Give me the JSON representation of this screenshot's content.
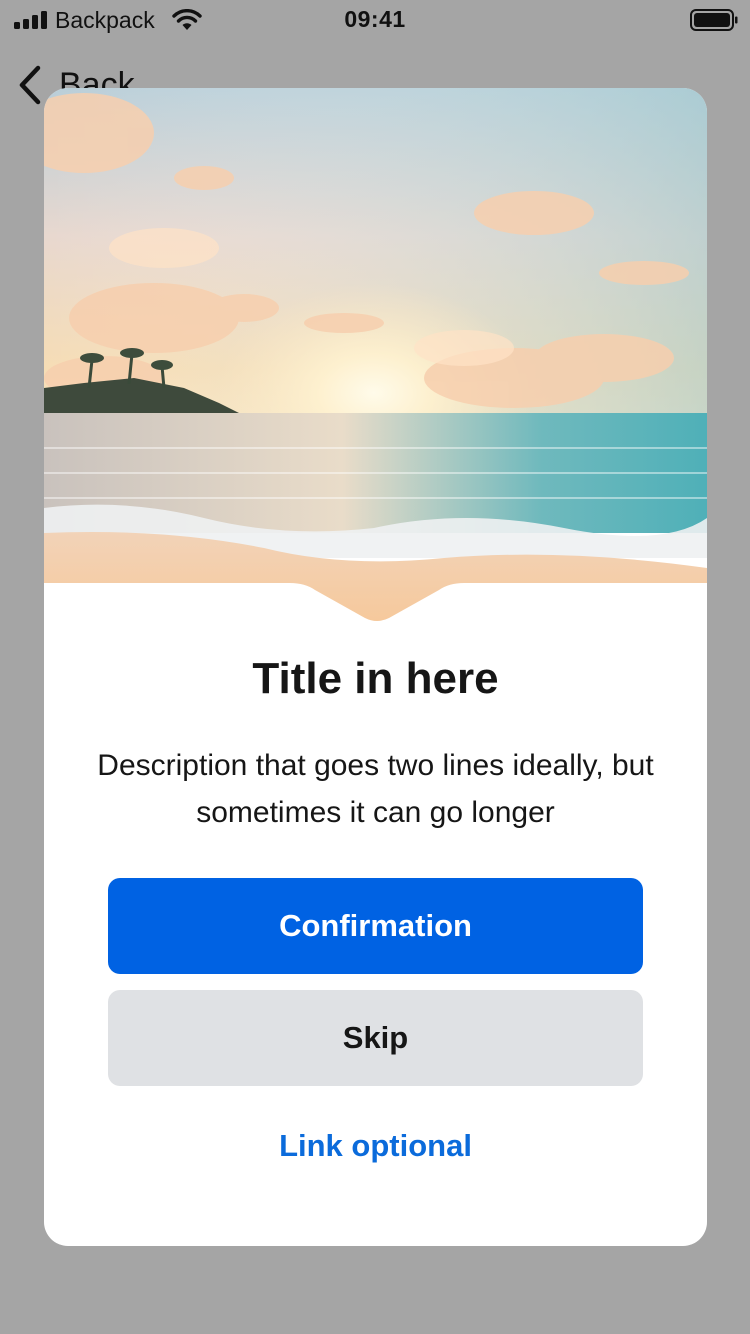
{
  "status_bar": {
    "carrier": "Backpack",
    "time": "09:41"
  },
  "nav": {
    "back_label": "Back"
  },
  "modal": {
    "title": "Title in here",
    "description": "Description that goes two lines ideally, but sometimes it can go longer",
    "primary_button": "Confirmation",
    "secondary_button": "Skip",
    "link": "Link optional"
  },
  "colors": {
    "primary": "#0062e3",
    "secondary": "#dfe1e4",
    "link": "#0b6bdb",
    "backdrop": "#a5a5a5"
  }
}
